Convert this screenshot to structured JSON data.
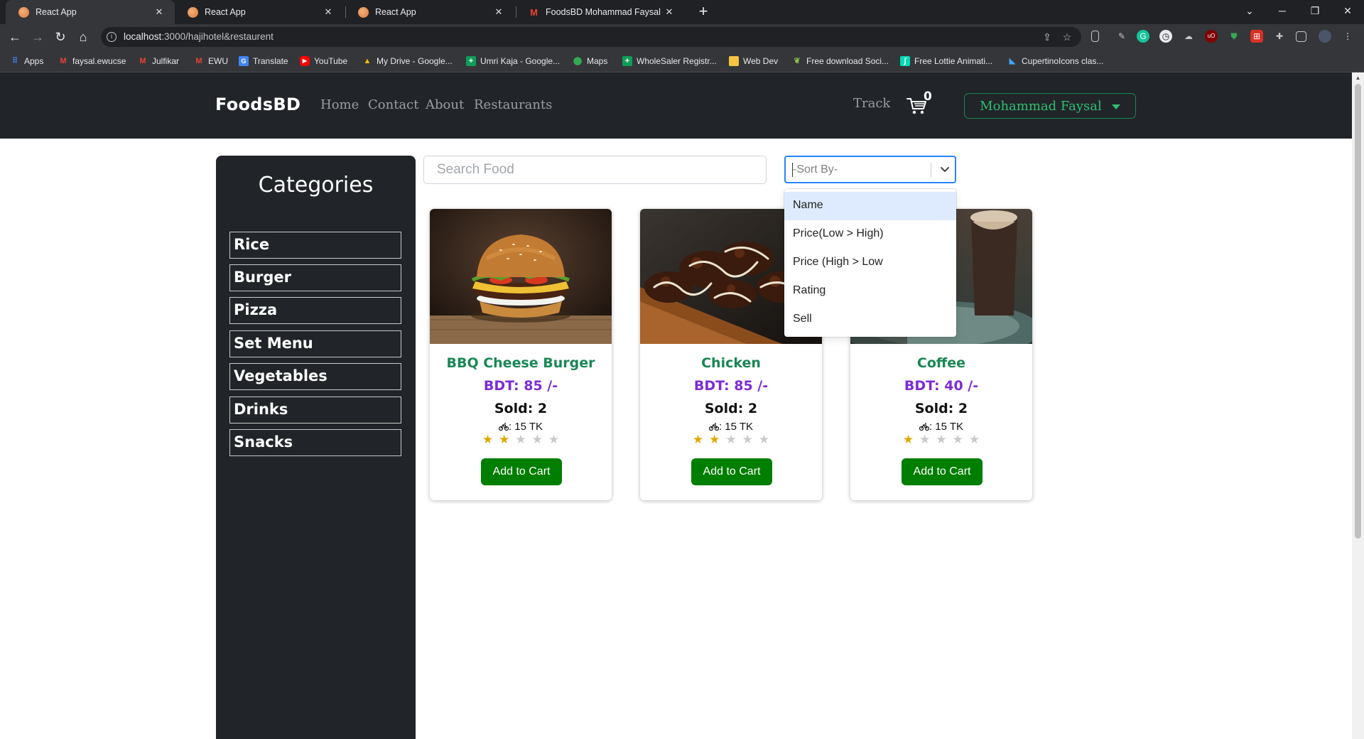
{
  "browser": {
    "tabs": [
      {
        "title": "React App",
        "favicon": "react-app-icon",
        "active": true
      },
      {
        "title": "React App",
        "favicon": "react-app-icon",
        "active": false
      },
      {
        "title": "React App",
        "favicon": "react-app-icon",
        "active": false
      },
      {
        "title": "FoodsBD Mohammad Faysal - fa",
        "favicon": "gmail-icon",
        "active": false
      }
    ],
    "url_host": "localhost",
    "url_rest": ":3000/hajihotel&restaurent",
    "bookmarks": [
      {
        "label": "Apps",
        "icon": "apps-grid-icon",
        "color": "#4285f4"
      },
      {
        "label": "faysal.ewucse",
        "icon": "gmail-icon",
        "color": "#ea4335"
      },
      {
        "label": "Julfikar",
        "icon": "gmail-icon",
        "color": "#ea4335"
      },
      {
        "label": "EWU",
        "icon": "gmail-icon",
        "color": "#ea4335"
      },
      {
        "label": "Translate",
        "icon": "translate-icon",
        "color": "#4285f4"
      },
      {
        "label": "YouTube",
        "icon": "youtube-icon",
        "color": "#ff0000"
      },
      {
        "label": "My Drive - Google...",
        "icon": "drive-icon",
        "color": "#fbbc04"
      },
      {
        "label": "Umri Kaja - Google...",
        "icon": "sheets-icon",
        "color": "#0f9d58"
      },
      {
        "label": "Maps",
        "icon": "maps-icon",
        "color": "#34a853"
      },
      {
        "label": "WholeSaler Registr...",
        "icon": "sheets-icon",
        "color": "#0f9d58"
      },
      {
        "label": "Web Dev",
        "icon": "folder-icon",
        "color": "#f6c343"
      },
      {
        "label": "Free download Soci...",
        "icon": "leaf-icon",
        "color": "#8bc34a"
      },
      {
        "label": "Free Lottie Animati...",
        "icon": "lottie-icon",
        "color": "#00ddb3"
      },
      {
        "label": "CupertinoIcons clas...",
        "icon": "flutter-icon",
        "color": "#42a5f5"
      }
    ]
  },
  "nav": {
    "brand": "FoodsBD",
    "links": [
      "Home",
      "Contact",
      "About",
      "Restaurants"
    ],
    "track": "Track",
    "cart_count": "0",
    "user": "Mohammad Faysal"
  },
  "sidebar": {
    "title": "Categories",
    "categories": [
      "Rice",
      "Burger",
      "Pizza",
      "Set Menu",
      "Vegetables",
      "Drinks",
      "Snacks"
    ]
  },
  "search": {
    "placeholder": "Search Food"
  },
  "sort": {
    "placeholder": "-Sort By-",
    "options": [
      "Name",
      "Price(Low > High)",
      "Price (High > Low",
      "Rating",
      "Sell"
    ],
    "focused_index": 0
  },
  "foods": [
    {
      "name": "BBQ Cheese Burger",
      "price": "BDT: 85 /-",
      "sold": "Sold: 2",
      "delivery": ": 15 TK",
      "rating": 2,
      "button": "Add to Cart",
      "image": "burger-photo"
    },
    {
      "name": "Chicken",
      "price": "BDT: 85 /-",
      "sold": "Sold: 2",
      "delivery": ": 15 TK",
      "rating": 2,
      "button": "Add to Cart",
      "image": "chicken-photo"
    },
    {
      "name": "Coffee",
      "price": "BDT: 40 /-",
      "sold": "Sold: 2",
      "delivery": ": 15 TK",
      "rating": 1,
      "button": "Add to Cart",
      "image": "coffee-photo"
    }
  ],
  "rating_max": 5,
  "colors": {
    "navbar": "#212529",
    "brand_green": "#198754",
    "price_purple": "#7e2bd5",
    "cart_button": "#007e00",
    "star_on": "#e0a800",
    "select_focus": "#2684ff",
    "option_focus": "#deebff"
  }
}
